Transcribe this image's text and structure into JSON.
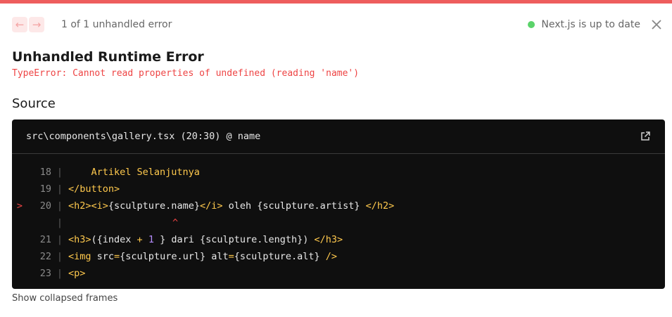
{
  "colors": {
    "accent_red": "#ee5d5d",
    "code_bg": "#0f0f0f",
    "keyword": "#ffc94d",
    "number": "#b58cff",
    "status_dot": "#5bd36a"
  },
  "header": {
    "prev_icon": "arrow-left-icon",
    "next_icon": "arrow-right-icon",
    "count_label": "1 of 1 unhandled error",
    "status_label": "Next.js is up to date",
    "close_icon": "close-icon"
  },
  "error": {
    "title": "Unhandled Runtime Error",
    "message": "TypeError: Cannot read properties of undefined (reading 'name')"
  },
  "source": {
    "heading": "Source",
    "file": "src\\components\\gallery.tsx (20:30) @ name",
    "open_icon": "external-link-icon",
    "lines": [
      {
        "num": "18",
        "parts": {
          "a": "    Artikel Selanjutnya"
        }
      },
      {
        "num": "19",
        "parts": {
          "a": "</button>"
        }
      },
      {
        "num": "20",
        "marker": ">",
        "parts": {
          "a": "<h2><i>",
          "b": "{sculpture.name}",
          "c": "</i>",
          "d": " oleh {sculpture.artist} ",
          "e": "</h2>"
        }
      },
      {
        "num": "",
        "caret": "^"
      },
      {
        "num": "21",
        "parts": {
          "a": "<h3>",
          "b": "({index ",
          "c": "+",
          "d": " 1",
          "e": " } dari {sculpture.length}) ",
          "f": "</h3>"
        }
      },
      {
        "num": "22",
        "parts": {
          "a": "<img ",
          "b": "src",
          "c": "=",
          "d": "{sculpture.url} alt",
          "e": "=",
          "f": "{sculpture.alt} ",
          "g": "/>"
        }
      },
      {
        "num": "23",
        "parts": {
          "a": "<p>"
        }
      }
    ]
  },
  "footer": {
    "collapsed_label": "Show collapsed frames"
  }
}
